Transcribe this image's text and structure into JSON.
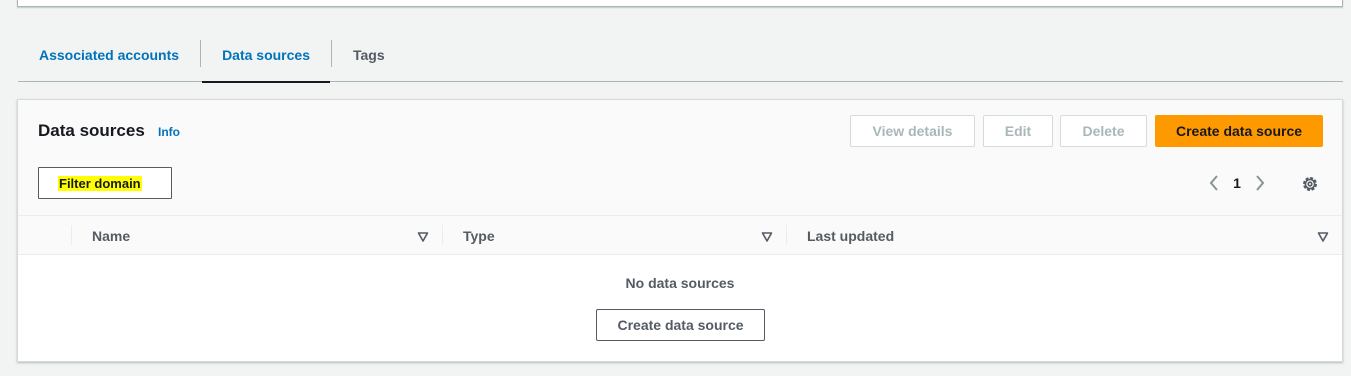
{
  "tabs": [
    {
      "label": "Associated accounts",
      "active": false
    },
    {
      "label": "Data sources",
      "active": true
    },
    {
      "label": "Tags",
      "active": false
    }
  ],
  "panel": {
    "title": "Data sources",
    "info_label": "Info",
    "actions": {
      "view_details": "View details",
      "edit": "Edit",
      "delete": "Delete",
      "create": "Create data source"
    },
    "filter": {
      "value": "Filter domain",
      "highlighted": true
    },
    "pagination": {
      "current_page": "1",
      "prev_icon": "chevron-left-icon",
      "next_icon": "chevron-right-icon"
    },
    "settings_icon": "gear-icon"
  },
  "table": {
    "columns": [
      {
        "label": "Name"
      },
      {
        "label": "Type"
      },
      {
        "label": "Last updated"
      }
    ],
    "rows": [],
    "empty_message": "No data sources",
    "empty_action": "Create data source"
  },
  "colors": {
    "primary_button": "#ff9900",
    "link": "#0073bb",
    "highlight": "#ffff00"
  }
}
